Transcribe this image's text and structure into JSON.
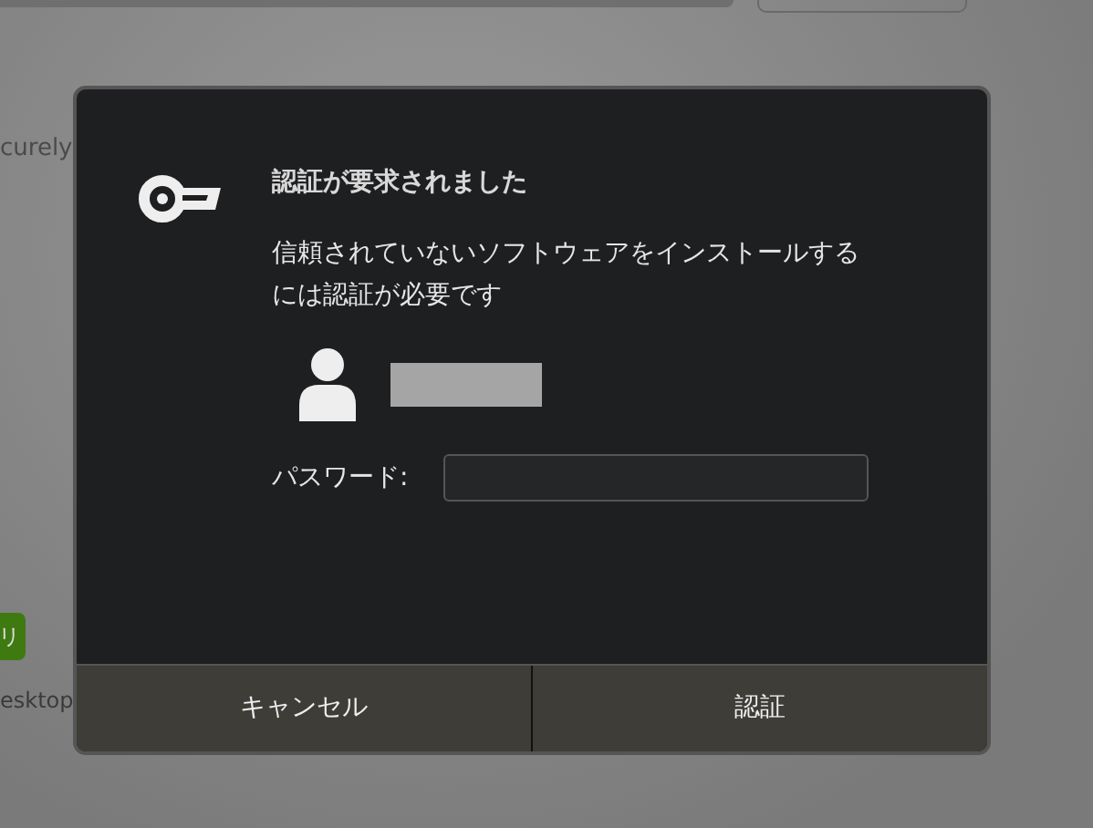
{
  "background": {
    "description_fragment": "curely",
    "button_fragment": "リ",
    "label_fragment": "esktop"
  },
  "dialog": {
    "title": "認証が要求されました",
    "message": "信頼されていないソフトウェアをインストールするには認証が必要です",
    "password_label": "パスワード:",
    "buttons": [
      {
        "label": "キャンセル"
      },
      {
        "label": "認証"
      }
    ]
  }
}
